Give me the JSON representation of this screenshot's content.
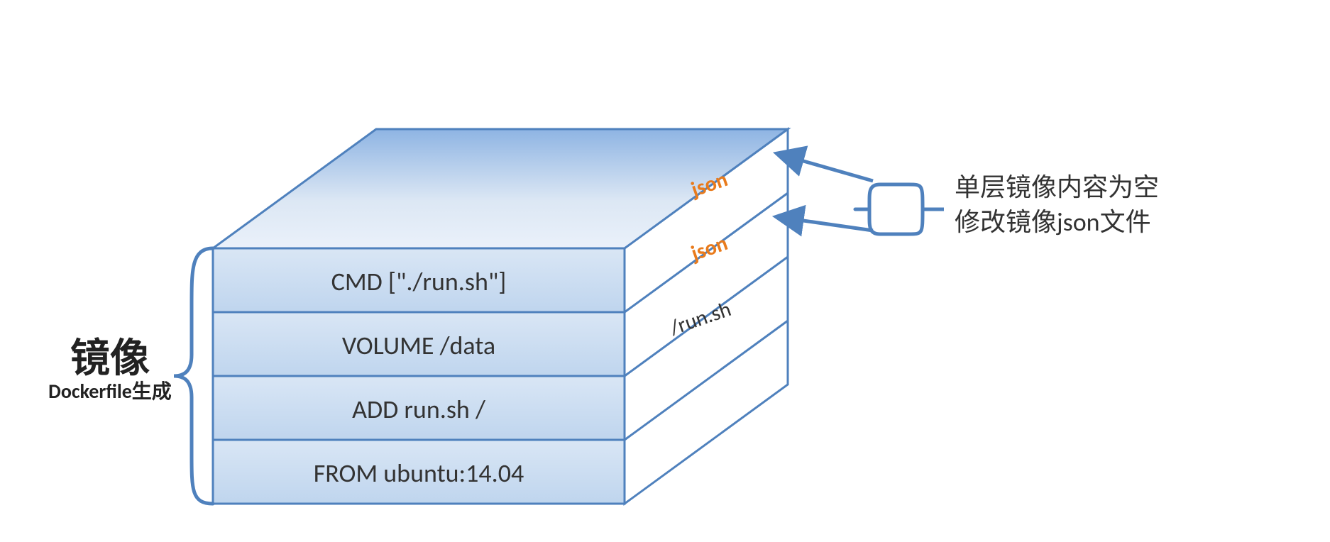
{
  "left_label": {
    "title": "镜像",
    "subtitle": "Dockerfile生成"
  },
  "layers": {
    "top": "CMD [\"./run.sh\"]",
    "second": "VOLUME /data",
    "third": "ADD run.sh /",
    "bottom": "FROM ubuntu:14.04"
  },
  "side_labels": {
    "s1": "json",
    "s2": "json",
    "s3": "/run.sh"
  },
  "annotation": {
    "line1": "单层镜像内容为空",
    "line2": "修改镜像json文件"
  },
  "colors": {
    "stroke": "#4f81bd",
    "fill_light": "#e7eff9",
    "fill_mid": "#c6d9ef",
    "fill_top1": "#8eb4e3",
    "fill_top2": "#dce7f4",
    "side_fill": "#ffffff",
    "json_color": "#e97b1c"
  }
}
